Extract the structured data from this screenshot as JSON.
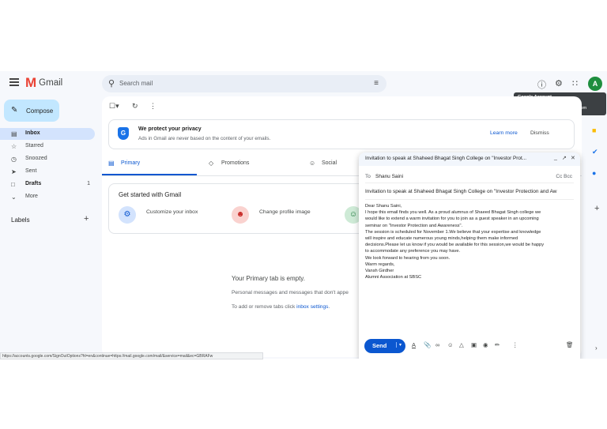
{
  "header": {
    "app_name": "Gmail",
    "logo_letter": "M",
    "search_placeholder": "Search mail",
    "avatar_letter": "A",
    "account_tooltip": {
      "title": "Google Account",
      "name": "Alumni Association _SBSC",
      "email": "alumniassociationsbsc@gmail.com"
    }
  },
  "sidebar": {
    "compose_label": "Compose",
    "items": [
      {
        "label": "Inbox",
        "icon": "inbox-icon",
        "count": ""
      },
      {
        "label": "Starred",
        "icon": "star-icon",
        "count": ""
      },
      {
        "label": "Snoozed",
        "icon": "clock-icon",
        "count": ""
      },
      {
        "label": "Sent",
        "icon": "send-icon",
        "count": ""
      },
      {
        "label": "Drafts",
        "icon": "draft-icon",
        "count": "1"
      },
      {
        "label": "More",
        "icon": "chevron-down-icon",
        "count": ""
      }
    ],
    "labels_heading": "Labels"
  },
  "privacy_banner": {
    "title": "We protect your privacy",
    "subtitle": "Ads in Gmail are never based on the content of your emails.",
    "learn_more": "Learn more",
    "dismiss": "Dismiss"
  },
  "tabs": [
    {
      "label": "Primary"
    },
    {
      "label": "Promotions"
    },
    {
      "label": "Social"
    }
  ],
  "get_started": {
    "title": "Get started with Gmail",
    "items": [
      {
        "label": "Customize your inbox"
      },
      {
        "label": "Change profile image"
      }
    ]
  },
  "empty_state": {
    "title": "Your Primary tab is empty.",
    "line1": "Personal messages and messages that don't appe",
    "line2_prefix": "To add or remove tabs click ",
    "line2_link": "inbox settings",
    "line2_suffix": "."
  },
  "compose_window": {
    "title": "Invitation to speak at Shaheed Bhagat Singh College on \"Investor Prot...",
    "to_label": "To",
    "to_value": "Shanu Saini",
    "cc_bcc": "Cc Bcc",
    "subject": "Invitation to speak at Shaheed Bhagat Singh College on \"Investor Protection and Aw",
    "body_lines": [
      "Dear Shanu Saini,",
      "I hope this email finds you well. As a proud alumnus of Shaeed Bhagat Singh college we",
      "would like to extend a warm invitation for you to join as a guest speaker in an upcoming",
      "seminar on \"Investor Protection and Awareness\".",
      "The session is scheduled for November 1.We believe that your expertise and knowledge",
      "will inspire and educate numerous young minds,helping them make informed",
      "decisions.Please let us know if you would be available for this session,we would be happy",
      "to accommodate any preference you may have.",
      "We look forward to hearing from you soon.",
      "Warm regards,",
      "Vansh Girdher",
      "Alumni Association at SBSC"
    ],
    "send_label": "Send"
  },
  "status_url": "https://accounts.google.com/SignOutOptions?hl=en&continue=https://mail.google.com/mail/&service=mail&ec=GBRAFw",
  "colors": {
    "compose_bg": "#c2e7ff",
    "active_nav": "#d3e3fd",
    "accent_blue": "#0b57d0",
    "gmail_red": "#ea4335",
    "avatar_green": "#1e8e3e"
  }
}
